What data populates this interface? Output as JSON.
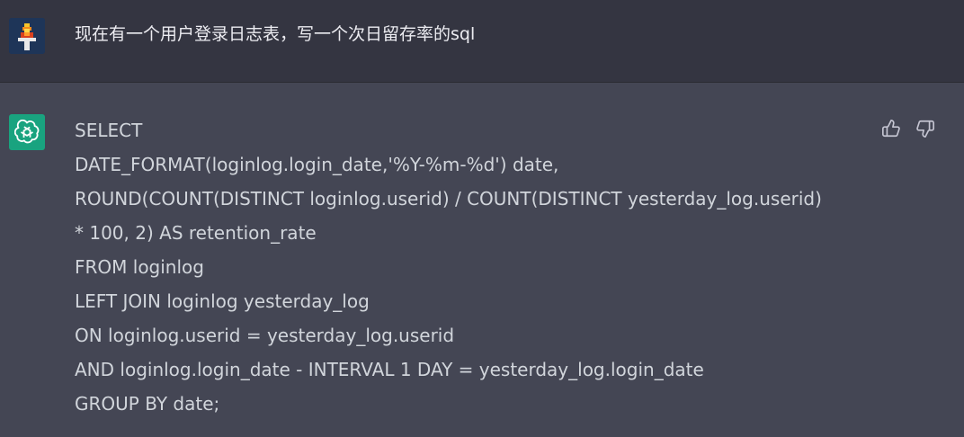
{
  "user": {
    "avatar_icon": "pixel-art-user-avatar",
    "message": "现在有一个用户登录日志表，写一个次日留存率的sql"
  },
  "assistant": {
    "avatar_icon": "openai-logo-icon",
    "avatar_color": "#19a37f",
    "lines": [
      "SELECT",
      "DATE_FORMAT(loginlog.login_date,'%Y-%m-%d') date,",
      "ROUND(COUNT(DISTINCT loginlog.userid) / COUNT(DISTINCT yesterday_log.userid)",
      "* 100, 2) AS retention_rate",
      "FROM loginlog",
      "LEFT JOIN loginlog yesterday_log",
      "ON loginlog.userid = yesterday_log.userid",
      "AND loginlog.login_date - INTERVAL 1 DAY = yesterday_log.login_date",
      "GROUP BY date;"
    ]
  },
  "feedback": {
    "thumbs_up_icon": "thumbs-up-icon",
    "thumbs_down_icon": "thumbs-down-icon"
  },
  "colors": {
    "user_bg": "#343541",
    "assistant_bg": "#444654",
    "text": "#d1d5db"
  }
}
